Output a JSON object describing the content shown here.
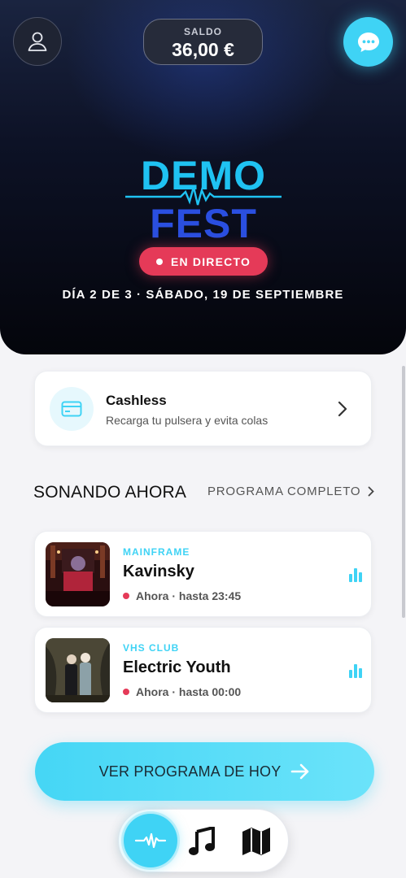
{
  "header": {
    "balance_label": "SALDO",
    "balance_value": "36,00 €"
  },
  "event": {
    "logo_line1": "DEMO",
    "logo_line2": "FEST",
    "live_label": "EN DIRECTO",
    "date_line": "DÍA 2 DE 3 · SÁBADO, 19 DE SEPTIEMBRE"
  },
  "cashless": {
    "title": "Cashless",
    "subtitle": "Recarga tu pulsera y evita colas"
  },
  "now_playing": {
    "title": "SONANDO AHORA",
    "link": "PROGRAMA COMPLETO",
    "items": [
      {
        "stage": "MAINFRAME",
        "artist": "Kavinsky",
        "time": "Ahora · hasta 23:45"
      },
      {
        "stage": "VHS CLUB",
        "artist": "Electric Youth",
        "time": "Ahora · hasta 00:00"
      }
    ]
  },
  "cta": {
    "label": "VER PROGRAMA DE HOY"
  },
  "nav": {
    "items": [
      "live-icon",
      "music-icon",
      "map-icon"
    ]
  },
  "colors": {
    "accent": "#3fd3f5",
    "live": "#e53a58",
    "logo_top": "#1fc2f2",
    "logo_bottom": "#2a4fe0"
  }
}
